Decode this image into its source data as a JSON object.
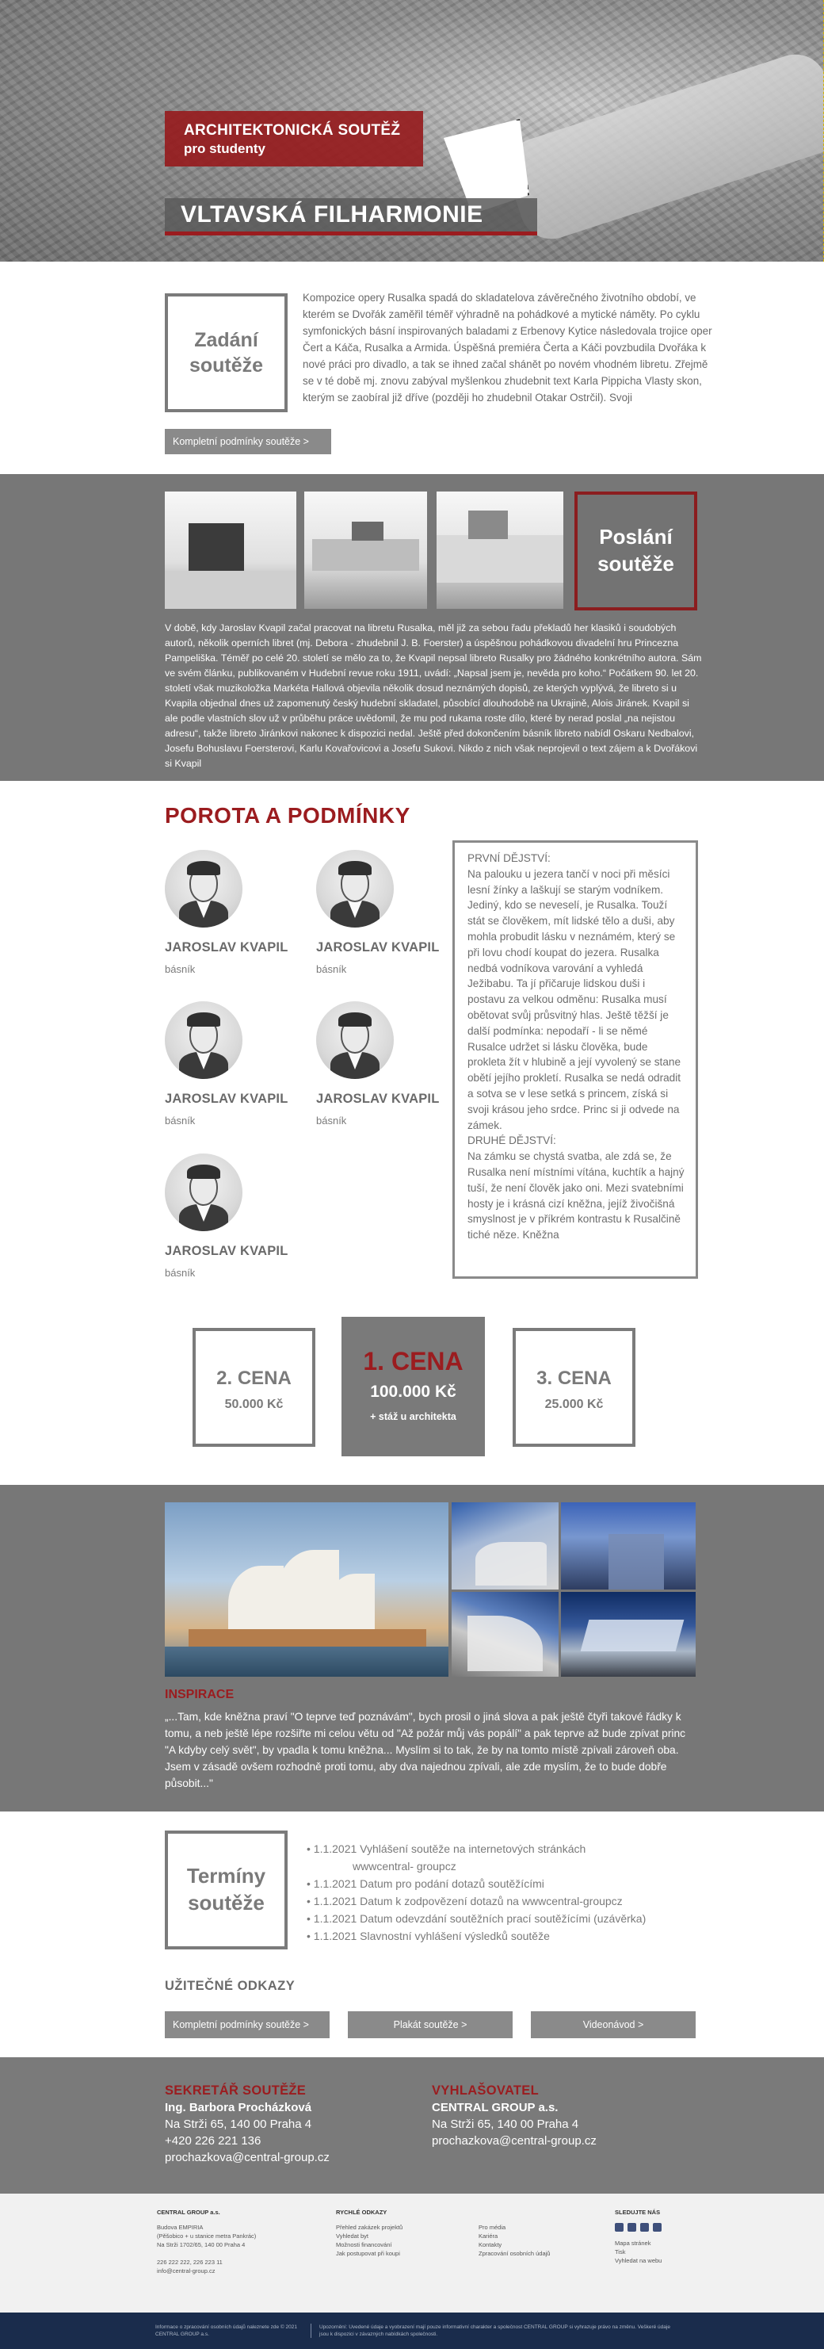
{
  "hero": {
    "badge_line1": "ARCHITEKTONICKÁ SOUTĚŽ",
    "badge_line2": "pro studenty",
    "title": "VLTAVSKÁ FILHARMONIE"
  },
  "zadani": {
    "box_label_line1": "Zadání",
    "box_label_line2": "soutěže",
    "text": "Kompozice opery Rusalka spadá do skladatelova závěrečného životního období, ve kterém se Dvořák zaměřil téměř výhradně na pohádkové a mytické náměty. Po cyklu symfonických básní inspirovaných baladami z Erbenovy Kytice následovala trojice oper Čert a Káča, Rusalka a Armida. Úspěšná premiéra Čerta a Káči povzbudila Dvořáka k nové práci pro divadlo, a tak se ihned začal shánět po novém vhodném libretu. Zřejmě se v té době mj. znovu zabýval myšlenkou zhudebnit text Karla Pippicha Vlasty skon, kterým se zaobíral již dříve (později ho zhudebnil Otakar Ostrčil). Svoji",
    "button": "Kompletní podmínky soutěže   >"
  },
  "poslani": {
    "box_label_line1": "Poslání",
    "box_label_line2": "soutěže",
    "text": "V době, kdy Jaroslav Kvapil začal pracovat na libretu Rusalka, měl již za sebou řadu překladů her klasiků i soudobých autorů, několik operních libret (mj. Debora - zhudebnil J. B. Foerster) a úspěšnou pohádkovou divadelní hru Princezna Pampeliška. Téměř po celé 20. století se mělo za to, že Kvapil nepsal libreto Rusalky pro žádného konkrétního autora. Sám ve svém článku, publikovaném v Hudební revue roku 1911, uvádí: „Napsal jsem je, nevěda pro koho.“ Počátkem 90. let 20. století však muzikoložka Markéta Hallová objevila několik dosud neznámých dopisů, ze kterých vyplývá, že libreto si u Kvapila objednal dnes už zapomenutý český hudební skladatel, působící dlouhodobě na Ukrajině, Alois Jiránek. Kvapil si ale podle vlastních slov už v průběhu práce uvědomil, že mu pod rukama roste dílo, které by nerad poslal „na nejistou adresu“, takže libreto Jiránkovi nakonec k dispozici nedal. Ještě před dokončením básník libreto nabídl Oskaru Nedbalovi, Josefu Bohuslavu Foersterovi, Karlu Kovařovicovi a Josefu Sukovi. Nikdo z nich však neprojevil o text zájem a k Dvořákovi si Kvapil"
  },
  "porota": {
    "heading": "POROTA A PODMÍNKY",
    "members": [
      {
        "name": "JAROSLAV KVAPIL",
        "role": "básník"
      },
      {
        "name": "JAROSLAV KVAPIL",
        "role": "básník"
      },
      {
        "name": "JAROSLAV KVAPIL",
        "role": "básník"
      },
      {
        "name": "JAROSLAV KVAPIL",
        "role": "básník"
      },
      {
        "name": "JAROSLAV KVAPIL",
        "role": "básník"
      }
    ],
    "libreto": "PRVNÍ DĚJSTVÍ:\nNa palouku u jezera tančí v noci při měsíci lesní žínky a laškují se starým vodníkem. Jediný, kdo se neveselí, je Rusalka. Touží stát se člověkem, mít lidské tělo a duši, aby mohla probudit lásku v neznámém, který se při lovu chodí koupat do jezera. Rusalka nedbá vodníkova varování a vyhledá Ježibabu. Ta jí přičaruje lidskou duši i postavu za velkou odměnu: Rusalka musí obětovat svůj průsvitný hlas. Ještě těžší je další podmínka: nepodaří - li se němé Rusalce udržet si lásku člověka, bude prokleta žít v hlubině a její vyvolený se stane obětí jejího prokletí. Rusalka se nedá odradit a sotva se v lese setká s princem, získá si svoji krásou jeho srdce. Princ si ji odvede na zámek.\nDRUHÉ DĚJSTVÍ:\nNa zámku se chystá svatba, ale zdá se, že Rusalka není místními vítána, kuchtík a hajný tuší, že není člověk jako oni. Mezi svatebními hosty je i krásná cizí kněžna, jejíž živočišná smyslnost je v příkrém kontrastu k Rusalčině tiché něze. Kněžna"
  },
  "ceny": {
    "second": {
      "title": "2. CENA",
      "value": "50.000 Kč"
    },
    "first": {
      "title": "1. CENA",
      "value": "100.000 Kč",
      "extra": "+ stáž u architekta"
    },
    "third": {
      "title": "3. CENA",
      "value": "25.000 Kč"
    }
  },
  "inspirace": {
    "label": "INSPIRACE",
    "quote": "„...Tam, kde kněžna praví \"O teprve teď poznávám\", bych prosil o jiná slova a pak ještě čtyři takové řádky k tomu, a neb ještě lépe rozšiřte mi celou větu od \"Až požár můj vás popálí\" a pak teprve až bude zpívat princ \"A kdyby celý svět\", by vpadla k tomu kněžna... Myslím si to tak, že by na tomto místě zpívali zároveň oba. Jsem v zásadě ovšem rozhodně proti tomu, aby dva najednou zpívali, ale zde myslím, že to bude dobře působit...\""
  },
  "terminy": {
    "box_label_line1": "Termíny",
    "box_label_line2": "soutěže",
    "items": [
      "• 1.1.2021 Vyhlášení soutěže na internetových stránkách",
      "wwwcentral- groupcz",
      "• 1.1.2021 Datum pro podání dotazů soutěžícími",
      "• 1.1.2021 Datum k zodpovězení dotazů na wwwcentral-groupcz",
      "• 1.1.2021 Datum odevzdání soutěžních prací soutěžícími (uzávěrka)",
      "• 1.1.2021 Slavnostní vyhlášení výsledků soutěže"
    ],
    "links_heading": "UŽITEČNÉ ODKAZY",
    "links": [
      "Kompletní podmínky soutěže   >",
      "Plakát soutěže   >",
      "Videonávod   >"
    ]
  },
  "contact": {
    "secretary": {
      "heading": "SEKRETÁŘ SOUTĚŽE",
      "name": "Ing. Barbora Procházková",
      "address": "Na Strži 65, 140 00 Praha 4",
      "phone": "+420 226 221 136",
      "email": "prochazkova@central-group.cz"
    },
    "announcer": {
      "heading": "VYHLAŠOVATEL",
      "name": "CENTRAL GROUP a.s.",
      "address": "Na Strži 65, 140 00 Praha 4",
      "email": "prochazkova@central-group.cz"
    }
  },
  "footer": {
    "col1_heading": "CENTRAL GROUP a.s.",
    "col1_lines": [
      "Budova EMPIRIA",
      "(Pěšobico + u stanice metra Pankrác)",
      "Na Strži 1702/65, 140 00 Praha 4",
      "",
      "226 222 222, 226 223 11",
      "info@central-group.cz"
    ],
    "col2_heading": "RYCHLÉ ODKAZY",
    "col2_lines": [
      "Přehled zakázek projektů",
      "Vyhledat byt",
      "Možnosti financování",
      "Jak postupovat při koupi"
    ],
    "col3_lines": [
      "Pro média",
      "Kariéra",
      "Kontakty",
      "Zpracování osobních údajů"
    ],
    "col4_heading": "SLEDUJTE NÁS",
    "col4_lines": [
      "Mapa stránek",
      "Tisk",
      "Vyhledat na webu"
    ],
    "bottom_left": "Informace o zpracování osobních údajů naleznete zde © 2021 CENTRAL GROUP a.s.",
    "bottom_right": "Upozornění: Uvedené údaje a vyobrazení mají pouze informativní charakter a společnost CENTRAL GROUP si vyhrazuje právo na změnu. Veškeré údaje jsou k dispozici v závazných nabídkách společnosti."
  }
}
